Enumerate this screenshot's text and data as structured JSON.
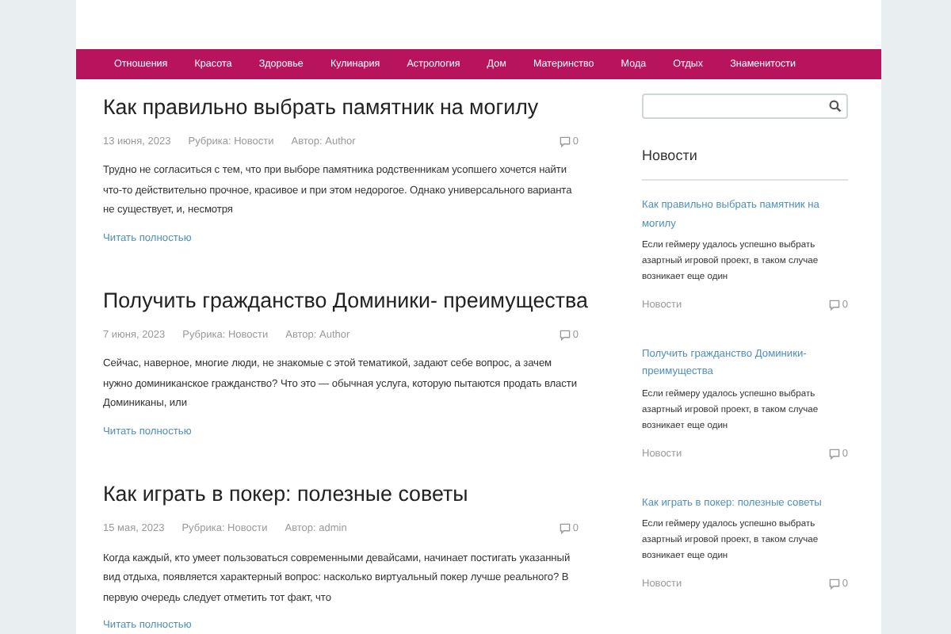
{
  "nav": [
    "Отношения",
    "Красота",
    "Здоровье",
    "Кулинария",
    "Астрология",
    "Дом",
    "Материнство",
    "Мода",
    "Отдых",
    "Знаменитости"
  ],
  "posts": [
    {
      "title": "Как правильно выбрать памятник на могилу",
      "date": "13 июня, 2023",
      "category": "Рубрика: Новости",
      "author": "Автор: Author",
      "comments": "0",
      "excerpt": "Трудно не согласиться с тем, что при выборе памятника родственникам усопшего хочется найти что-то действительно прочное, красивое и при этом недорогое. Однако универсального варианта не существует, и, несмотря",
      "more": "Читать полностью"
    },
    {
      "title": "Получить гражданство Доминики- преимущества",
      "date": "7 июня, 2023",
      "category": "Рубрика: Новости",
      "author": "Автор: Author",
      "comments": "0",
      "excerpt": "Сейчас, наверное, многие люди, не знакомые с этой тематикой, задают себе вопрос, а зачем нужно доминиканское гражданство? Что это — обычная услуга, которую пытаются продать власти Доминиканы, или",
      "more": "Читать полностью"
    },
    {
      "title": "Как играть в покер: полезные советы",
      "date": "15 мая, 2023",
      "category": "Рубрика: Новости",
      "author": "Автор: admin",
      "comments": "0",
      "excerpt": "Когда каждый, кто умеет пользоваться современными девайсами, начинает постигать указанный вид отдыха, появляется характерный вопрос: насколько виртуальный покер лучше реального? В первую очередь следует отметить тот факт, что",
      "more": "Читать полностью"
    }
  ],
  "sidebar": {
    "title": "Новости",
    "items": [
      {
        "title": "Как правильно выбрать памятник на могилу",
        "excerpt": "Если геймеру удалось успешно выбрать азартный игровой проект, в таком случае возникает еще один",
        "category": "Новости",
        "comments": "0"
      },
      {
        "title": "Получить гражданство Доминики- преимущества",
        "excerpt": "Если геймеру удалось успешно выбрать азартный игровой проект, в таком случае возникает еще один",
        "category": "Новости",
        "comments": "0"
      },
      {
        "title": "Как играть в покер: полезные советы",
        "excerpt": "Если геймеру удалось успешно выбрать азартный игровой проект, в таком случае возникает еще один",
        "category": "Новости",
        "comments": "0"
      }
    ]
  }
}
